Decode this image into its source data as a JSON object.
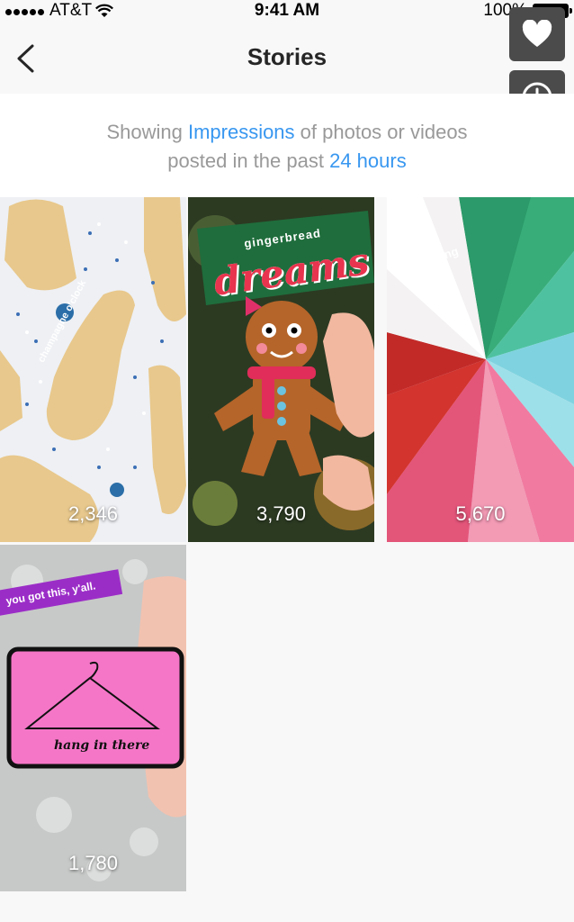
{
  "status_bar": {
    "carrier": "AT&T",
    "time": "9:41 AM",
    "battery": "100%"
  },
  "nav": {
    "title": "Stories"
  },
  "info": {
    "prefix": "Showing ",
    "metric": "Impressions",
    "middle": " of photos or videos",
    "line2_prefix": "posted in the past ",
    "period": "24 hours"
  },
  "stories": [
    {
      "caption": "champagne o'clock",
      "count": "2,346"
    },
    {
      "caption_top": "gingerbread",
      "caption_main": "dreams",
      "count": "3,790"
    },
    {
      "caption": "royal icing party",
      "count": "5,670"
    },
    {
      "caption": "you got this, y'all.",
      "count": "1,780",
      "card_text": "hang in there"
    }
  ]
}
